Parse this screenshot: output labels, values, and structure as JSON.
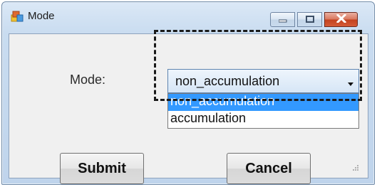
{
  "window": {
    "title": "Mode",
    "app_icon": "app-form-icon",
    "controls": {
      "minimize_icon": "minimize-icon",
      "maximize_icon": "maximize-icon",
      "close_icon": "close-icon"
    }
  },
  "form": {
    "mode_label": "Mode:",
    "mode_combo": {
      "value": "non_accumulation",
      "options": [
        "non_accumulation",
        "accumulation"
      ],
      "highlighted_index": 0
    },
    "submit_label": "Submit",
    "cancel_label": "Cancel"
  },
  "colors": {
    "selection_highlight": "#3399ff",
    "close_button": "#c4421f"
  }
}
